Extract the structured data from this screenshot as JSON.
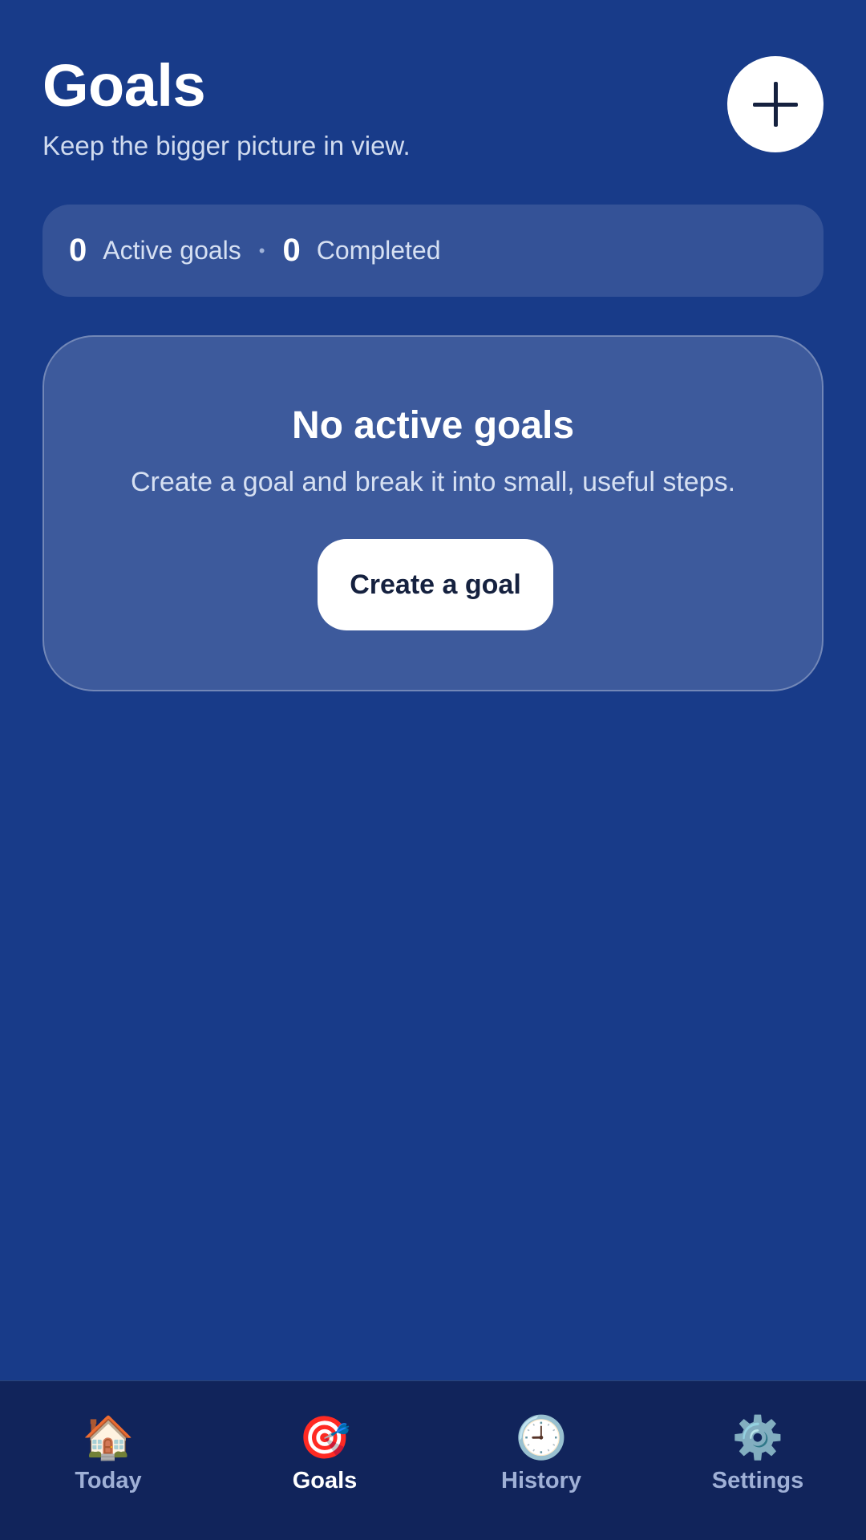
{
  "header": {
    "title": "Goals",
    "subtitle": "Keep the bigger picture in view.",
    "add_icon": "plus-icon"
  },
  "stats": {
    "active_count": "0",
    "active_label": "Active goals",
    "separator": "•",
    "completed_count": "0",
    "completed_label": "Completed"
  },
  "empty_state": {
    "title": "No active goals",
    "description": "Create a goal and break it into small, useful steps.",
    "button_label": "Create a goal"
  },
  "nav": {
    "active_tab": "Goals",
    "items": [
      {
        "label": "Today",
        "icon": "🏠",
        "icon_name": "house-icon"
      },
      {
        "label": "Goals",
        "icon": "🎯",
        "icon_name": "target-icon"
      },
      {
        "label": "History",
        "icon": "🕘",
        "icon_name": "clock-icon"
      },
      {
        "label": "Settings",
        "icon": "⚙️",
        "icon_name": "gear-icon"
      }
    ]
  },
  "colors": {
    "background": "#183b89",
    "nav_background": "#11245b",
    "card_surface": "#3a5796",
    "button_text": "#15213f",
    "muted_text": "#d0dbef"
  }
}
